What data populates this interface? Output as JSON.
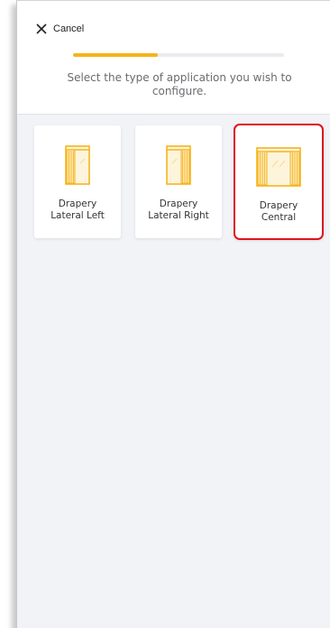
{
  "header": {
    "cancel_label": "Cancel",
    "progress_fraction": 0.4,
    "instruction": "Select the type of application you wish to configure."
  },
  "options": [
    {
      "label": "Drapery\nLateral Left",
      "icon": "drapery-lateral-left-icon",
      "selected": false
    },
    {
      "label": "Drapery\nLateral Right",
      "icon": "drapery-lateral-right-icon",
      "selected": false
    },
    {
      "label": "Drapery\nCentral",
      "icon": "drapery-central-icon",
      "selected": true
    }
  ],
  "colors": {
    "accent": "#f6b41a",
    "selection_border": "#e0121f",
    "background": "#f2f3f7"
  }
}
